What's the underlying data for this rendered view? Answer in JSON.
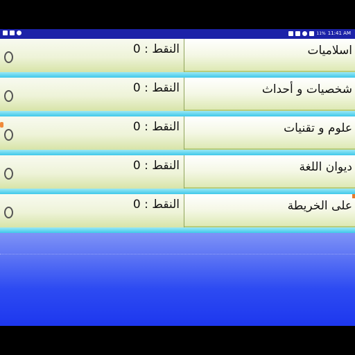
{
  "status_bar": {
    "time": "11:41 AM",
    "battery": "11%"
  },
  "categories": [
    {
      "title": "اسلاميات",
      "score_label": "النقط : 0"
    },
    {
      "title": "شخصيات و أحداث",
      "score_label": "النقط : 0"
    },
    {
      "title": "علوم و تقنيات",
      "score_label": "النقط : 0"
    },
    {
      "title": "ديوان  اللغة",
      "score_label": "النقط : 0"
    },
    {
      "title": "على الخريطة",
      "score_label": "النقط : 0"
    }
  ],
  "colors": {
    "status_bar": "#1c22a8",
    "row_bottom_strip": "#3fc8ea",
    "background_gradient_top": "#7f93f6",
    "background_gradient_bottom": "#1d37ee"
  }
}
